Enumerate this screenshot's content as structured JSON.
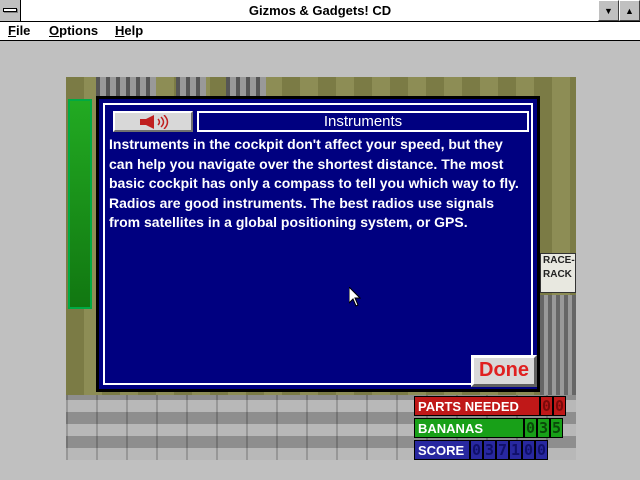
{
  "window": {
    "title": "Gizmos & Gadgets! CD",
    "minimize_glyph": "▼",
    "maximize_glyph": "▲"
  },
  "menu": [
    {
      "first": "F",
      "rest": "ile"
    },
    {
      "first": "O",
      "rest": "ptions"
    },
    {
      "first": "H",
      "rest": "elp"
    }
  ],
  "game_scene": {
    "sign_text": "RACE-\nRACK"
  },
  "dialog": {
    "title": "Instruments",
    "speaker_icon": "speaker-sound-icon",
    "body": "Instruments in the cockpit don't affect your speed, but they can help you navigate over the shortest distance. The most basic cockpit has only a compass to tell you which way to fly.  Radios are good instruments.  The best radios use signals from satellites in a global positioning system, or GPS.",
    "done_label": "Done"
  },
  "status": {
    "parts_needed": {
      "label": "PARTS NEEDED",
      "digits": [
        "0",
        "0"
      ]
    },
    "bananas": {
      "label": "BANANAS",
      "digits": [
        "0",
        "3",
        "5"
      ]
    },
    "score": {
      "label": "SCORE",
      "digits": [
        "0",
        "3",
        "7",
        "1",
        "0",
        "0"
      ]
    }
  },
  "colors": {
    "dialog_bg": "#000080",
    "done_text": "#e02020",
    "parts": "#c01818",
    "bananas": "#18a018",
    "score": "#2828a0"
  }
}
